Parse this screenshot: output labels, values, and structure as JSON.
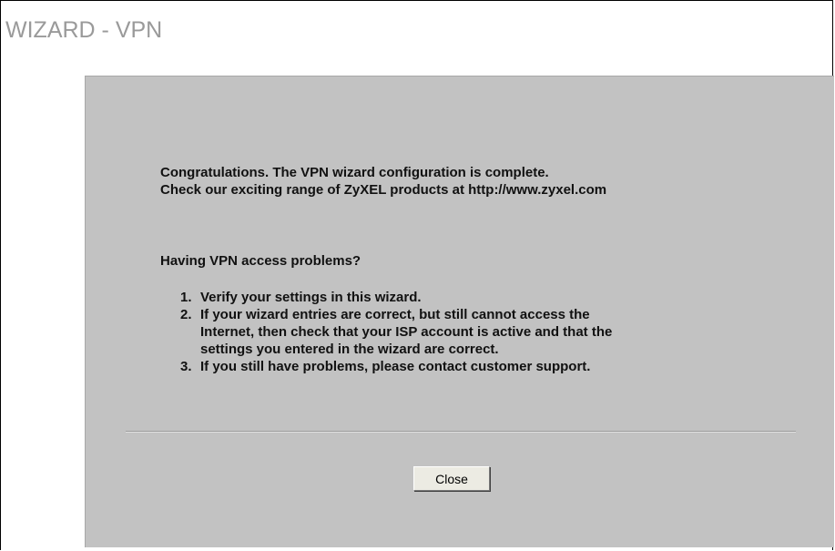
{
  "header": {
    "title": "WIZARD - VPN"
  },
  "content": {
    "congrats_line": "Congratulations. The VPN wizard configuration is complete.",
    "products_line": "Check our exciting range of ZyXEL products at http://www.zyxel.com",
    "problems_heading": "Having VPN access problems?",
    "steps": [
      {
        "number": "1.",
        "lines": [
          "Verify your settings in this wizard."
        ]
      },
      {
        "number": "2.",
        "lines": [
          "If your wizard entries are correct, but still cannot access the",
          "Internet, then check that your ISP account is active and that the",
          "settings you entered in the wizard are correct."
        ]
      },
      {
        "number": "3.",
        "lines": [
          "If you still have problems, please contact customer support."
        ]
      }
    ]
  },
  "footer": {
    "close_label": "Close"
  },
  "colors": {
    "title": "#9a9a9a",
    "panel_background": "#c2c2c2",
    "text": "#111111",
    "button_face": "#ecebe3"
  }
}
